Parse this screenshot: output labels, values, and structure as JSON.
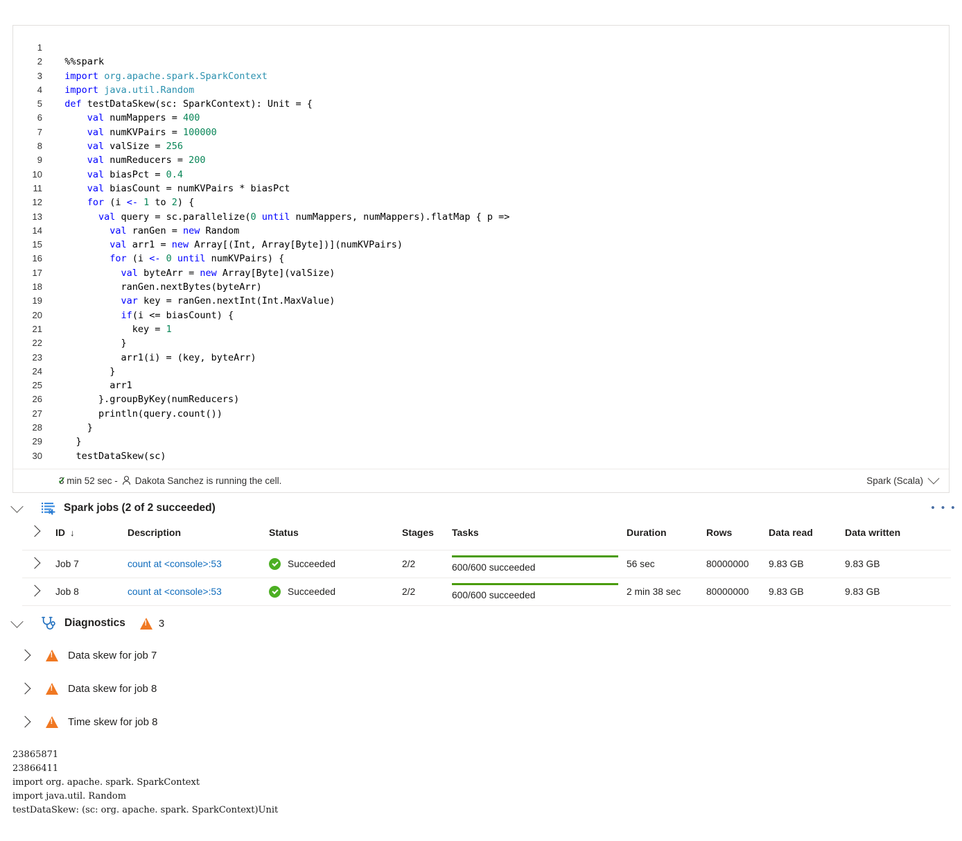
{
  "cell": {
    "language": "Spark (Scala)",
    "status_duration": "3 min 52 sec -",
    "status_user": "Dakota Sanchez is running the cell.",
    "lines": [
      {
        "n": "1",
        "tokens": []
      },
      {
        "n": "2",
        "tokens": [
          {
            "t": "  %%spark",
            "c": "code-text"
          }
        ]
      },
      {
        "n": "3",
        "tokens": [
          {
            "t": "  ",
            "c": "code-text"
          },
          {
            "t": "import",
            "c": "kw"
          },
          {
            "t": " ",
            "c": "code-text"
          },
          {
            "t": "org.apache.spark.SparkContext",
            "c": "pkg"
          }
        ]
      },
      {
        "n": "4",
        "tokens": [
          {
            "t": "  ",
            "c": "code-text"
          },
          {
            "t": "import",
            "c": "kw"
          },
          {
            "t": " ",
            "c": "code-text"
          },
          {
            "t": "java.util.Random",
            "c": "pkg"
          }
        ]
      },
      {
        "n": "5",
        "tokens": [
          {
            "t": "  ",
            "c": "code-text"
          },
          {
            "t": "def",
            "c": "kw"
          },
          {
            "t": " testDataSkew(sc: SparkContext): Unit = {",
            "c": "code-text"
          }
        ]
      },
      {
        "n": "6",
        "tokens": [
          {
            "t": "      ",
            "c": "code-text"
          },
          {
            "t": "val",
            "c": "kw"
          },
          {
            "t": " numMappers = ",
            "c": "code-text"
          },
          {
            "t": "400",
            "c": "num"
          }
        ]
      },
      {
        "n": "7",
        "tokens": [
          {
            "t": "      ",
            "c": "code-text"
          },
          {
            "t": "val",
            "c": "kw"
          },
          {
            "t": " numKVPairs = ",
            "c": "code-text"
          },
          {
            "t": "100000",
            "c": "num"
          }
        ]
      },
      {
        "n": "8",
        "tokens": [
          {
            "t": "      ",
            "c": "code-text"
          },
          {
            "t": "val",
            "c": "kw"
          },
          {
            "t": " valSize = ",
            "c": "code-text"
          },
          {
            "t": "256",
            "c": "num"
          }
        ]
      },
      {
        "n": "9",
        "tokens": [
          {
            "t": "      ",
            "c": "code-text"
          },
          {
            "t": "val",
            "c": "kw"
          },
          {
            "t": " numReducers = ",
            "c": "code-text"
          },
          {
            "t": "200",
            "c": "num"
          }
        ]
      },
      {
        "n": "10",
        "tokens": [
          {
            "t": "      ",
            "c": "code-text"
          },
          {
            "t": "val",
            "c": "kw"
          },
          {
            "t": " biasPct = ",
            "c": "code-text"
          },
          {
            "t": "0.4",
            "c": "num"
          }
        ]
      },
      {
        "n": "11",
        "tokens": [
          {
            "t": "      ",
            "c": "code-text"
          },
          {
            "t": "val",
            "c": "kw"
          },
          {
            "t": " biasCount = numKVPairs * biasPct",
            "c": "code-text"
          }
        ]
      },
      {
        "n": "12",
        "tokens": [
          {
            "t": "      ",
            "c": "code-text"
          },
          {
            "t": "for",
            "c": "kw"
          },
          {
            "t": " (i ",
            "c": "code-text"
          },
          {
            "t": "<-",
            "c": "kw"
          },
          {
            "t": " ",
            "c": "code-text"
          },
          {
            "t": "1",
            "c": "num"
          },
          {
            "t": " to ",
            "c": "code-text"
          },
          {
            "t": "2",
            "c": "num"
          },
          {
            "t": ") {",
            "c": "code-text"
          }
        ]
      },
      {
        "n": "13",
        "tokens": [
          {
            "t": "        ",
            "c": "code-text"
          },
          {
            "t": "val",
            "c": "kw"
          },
          {
            "t": " query = sc.parallelize(",
            "c": "code-text"
          },
          {
            "t": "0",
            "c": "num"
          },
          {
            "t": " ",
            "c": "code-text"
          },
          {
            "t": "until",
            "c": "kw"
          },
          {
            "t": " numMappers, numMappers).flatMap { p =>",
            "c": "code-text"
          }
        ]
      },
      {
        "n": "14",
        "tokens": [
          {
            "t": "          ",
            "c": "code-text"
          },
          {
            "t": "val",
            "c": "kw"
          },
          {
            "t": " ranGen = ",
            "c": "code-text"
          },
          {
            "t": "new",
            "c": "kw"
          },
          {
            "t": " Random",
            "c": "code-text"
          }
        ]
      },
      {
        "n": "15",
        "tokens": [
          {
            "t": "          ",
            "c": "code-text"
          },
          {
            "t": "val",
            "c": "kw"
          },
          {
            "t": " arr1 = ",
            "c": "code-text"
          },
          {
            "t": "new",
            "c": "kw"
          },
          {
            "t": " Array[(Int, Array[Byte])](numKVPairs)",
            "c": "code-text"
          }
        ]
      },
      {
        "n": "16",
        "tokens": [
          {
            "t": "          ",
            "c": "code-text"
          },
          {
            "t": "for",
            "c": "kw"
          },
          {
            "t": " (i ",
            "c": "code-text"
          },
          {
            "t": "<-",
            "c": "kw"
          },
          {
            "t": " ",
            "c": "code-text"
          },
          {
            "t": "0",
            "c": "num"
          },
          {
            "t": " ",
            "c": "code-text"
          },
          {
            "t": "until",
            "c": "kw"
          },
          {
            "t": " numKVPairs) {",
            "c": "code-text"
          }
        ]
      },
      {
        "n": "17",
        "tokens": [
          {
            "t": "            ",
            "c": "code-text"
          },
          {
            "t": "val",
            "c": "kw"
          },
          {
            "t": " byteArr = ",
            "c": "code-text"
          },
          {
            "t": "new",
            "c": "kw"
          },
          {
            "t": " Array[Byte](valSize)",
            "c": "code-text"
          }
        ]
      },
      {
        "n": "18",
        "tokens": [
          {
            "t": "            ranGen.nextBytes(byteArr)",
            "c": "code-text"
          }
        ]
      },
      {
        "n": "19",
        "tokens": [
          {
            "t": "            ",
            "c": "code-text"
          },
          {
            "t": "var",
            "c": "kw"
          },
          {
            "t": " key = ranGen.nextInt(Int.MaxValue)",
            "c": "code-text"
          }
        ]
      },
      {
        "n": "20",
        "tokens": [
          {
            "t": "            ",
            "c": "code-text"
          },
          {
            "t": "if",
            "c": "kw"
          },
          {
            "t": "(i <= biasCount) {",
            "c": "code-text"
          }
        ]
      },
      {
        "n": "21",
        "tokens": [
          {
            "t": "              key = ",
            "c": "code-text"
          },
          {
            "t": "1",
            "c": "num"
          }
        ]
      },
      {
        "n": "22",
        "tokens": [
          {
            "t": "            }",
            "c": "code-text"
          }
        ]
      },
      {
        "n": "23",
        "tokens": [
          {
            "t": "            arr1(i) = (key, byteArr)",
            "c": "code-text"
          }
        ]
      },
      {
        "n": "24",
        "tokens": [
          {
            "t": "          }",
            "c": "code-text"
          }
        ]
      },
      {
        "n": "25",
        "tokens": [
          {
            "t": "          arr1",
            "c": "code-text"
          }
        ]
      },
      {
        "n": "26",
        "tokens": [
          {
            "t": "        }.groupByKey(numReducers)",
            "c": "code-text"
          }
        ]
      },
      {
        "n": "27",
        "tokens": [
          {
            "t": "        println(query.count())",
            "c": "code-text"
          }
        ]
      },
      {
        "n": "28",
        "tokens": [
          {
            "t": "      }",
            "c": "code-text"
          }
        ]
      },
      {
        "n": "29",
        "tokens": [
          {
            "t": "    }",
            "c": "code-text"
          }
        ]
      },
      {
        "n": "30",
        "tokens": [
          {
            "t": "    testDataSkew(sc)",
            "c": "code-text"
          }
        ]
      }
    ]
  },
  "spark_jobs": {
    "title": "Spark jobs (2 of 2 succeeded)",
    "icon": "spark-jobs-icon",
    "overflow_label": "• • •",
    "columns": [
      "ID",
      "Description",
      "Status",
      "Stages",
      "Tasks",
      "Duration",
      "Rows",
      "Data read",
      "Data written"
    ],
    "sort_arrow": "↓",
    "rows": [
      {
        "id": "Job 7",
        "description": "count at <console>:53",
        "status": "Succeeded",
        "stages": "2/2",
        "tasks": "600/600 succeeded",
        "tasks_pct": 100,
        "duration": "56 sec",
        "rows": "80000000",
        "data_read": "9.83 GB",
        "data_written": "9.83 GB"
      },
      {
        "id": "Job 8",
        "description": "count at <console>:53",
        "status": "Succeeded",
        "stages": "2/2",
        "tasks": "600/600 succeeded",
        "tasks_pct": 100,
        "duration": "2 min 38 sec",
        "rows": "80000000",
        "data_read": "9.83 GB",
        "data_written": "9.83 GB"
      }
    ]
  },
  "diagnostics": {
    "title": "Diagnostics",
    "count": "3",
    "items": [
      {
        "label": "Data skew for job 7"
      },
      {
        "label": "Data skew for job 8"
      },
      {
        "label": "Time skew for job 8"
      }
    ]
  },
  "console_output": "23865871\n23866411\nimport org. apache. spark. SparkContext\nimport java.util. Random\ntestDataSkew: (sc: org. apache. spark. SparkContext)Unit",
  "colors": {
    "accent_link": "#0f6cbd",
    "success": "#4caf23",
    "progress": "#4a9c0a",
    "warning": "#f07822",
    "keyword": "#0000ff",
    "package": "#2b91af",
    "number": "#098658"
  }
}
